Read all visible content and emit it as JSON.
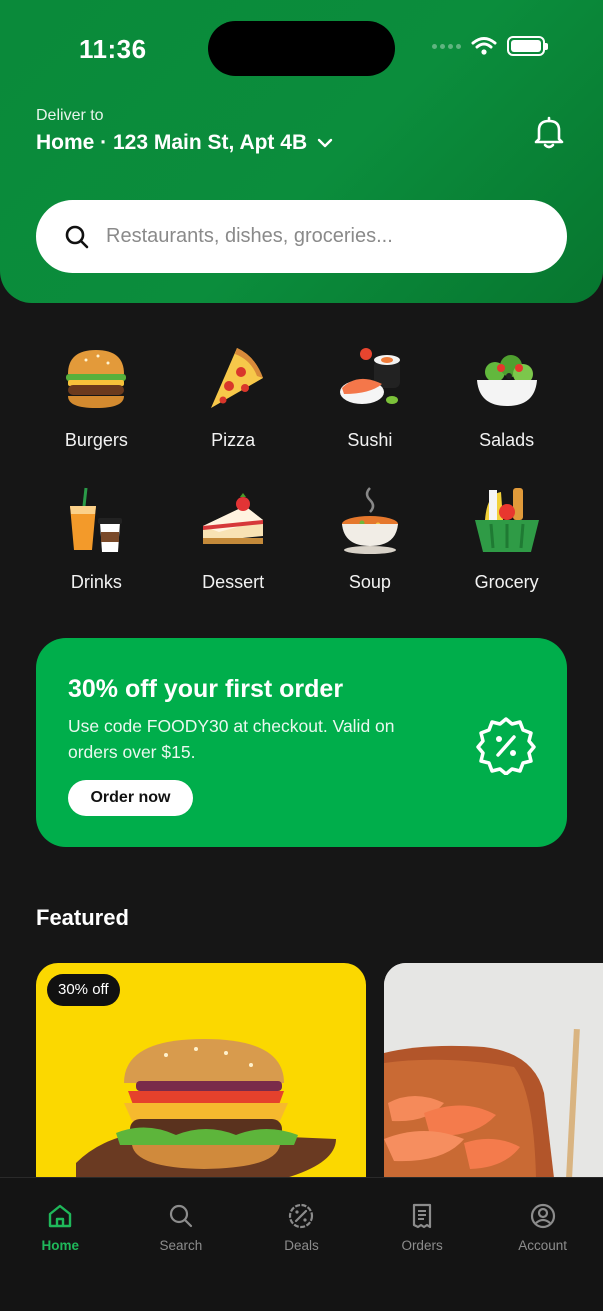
{
  "status_bar": {
    "time": "11:36"
  },
  "header": {
    "deliver_label": "Deliver to",
    "address": "Home · 123 Main St, Apt 4B",
    "notification_icon": "bell-icon"
  },
  "search": {
    "placeholder": "Restaurants, dishes, groceries...",
    "icon": "search-icon"
  },
  "categories": [
    {
      "label": "Burgers"
    },
    {
      "label": "Pizza"
    },
    {
      "label": "Sushi"
    },
    {
      "label": "Salads"
    },
    {
      "label": "Drinks"
    },
    {
      "label": "Dessert"
    },
    {
      "label": "Soup"
    },
    {
      "label": "Grocery"
    }
  ],
  "promo": {
    "title": "30% off your first order",
    "text": "Use code FOODY30 at checkout. Valid on orders over $15.",
    "button": "Order now",
    "icon": "discount-badge-icon"
  },
  "featured": {
    "title": "Featured",
    "cards": [
      {
        "badge": "30% off",
        "image": "burger-photo"
      },
      {
        "image": "sushi-photo"
      }
    ]
  },
  "nav": [
    {
      "label": "Home",
      "icon": "home-icon",
      "active": true
    },
    {
      "label": "Search",
      "icon": "search-icon"
    },
    {
      "label": "Deals",
      "icon": "deals-icon"
    },
    {
      "label": "Orders",
      "icon": "receipt-icon"
    },
    {
      "label": "Account",
      "icon": "account-icon"
    }
  ],
  "colors": {
    "brand_green": "#0b8d3c",
    "promo_green": "#00ae4b",
    "active_nav": "#1fb85a",
    "background": "#161616"
  }
}
